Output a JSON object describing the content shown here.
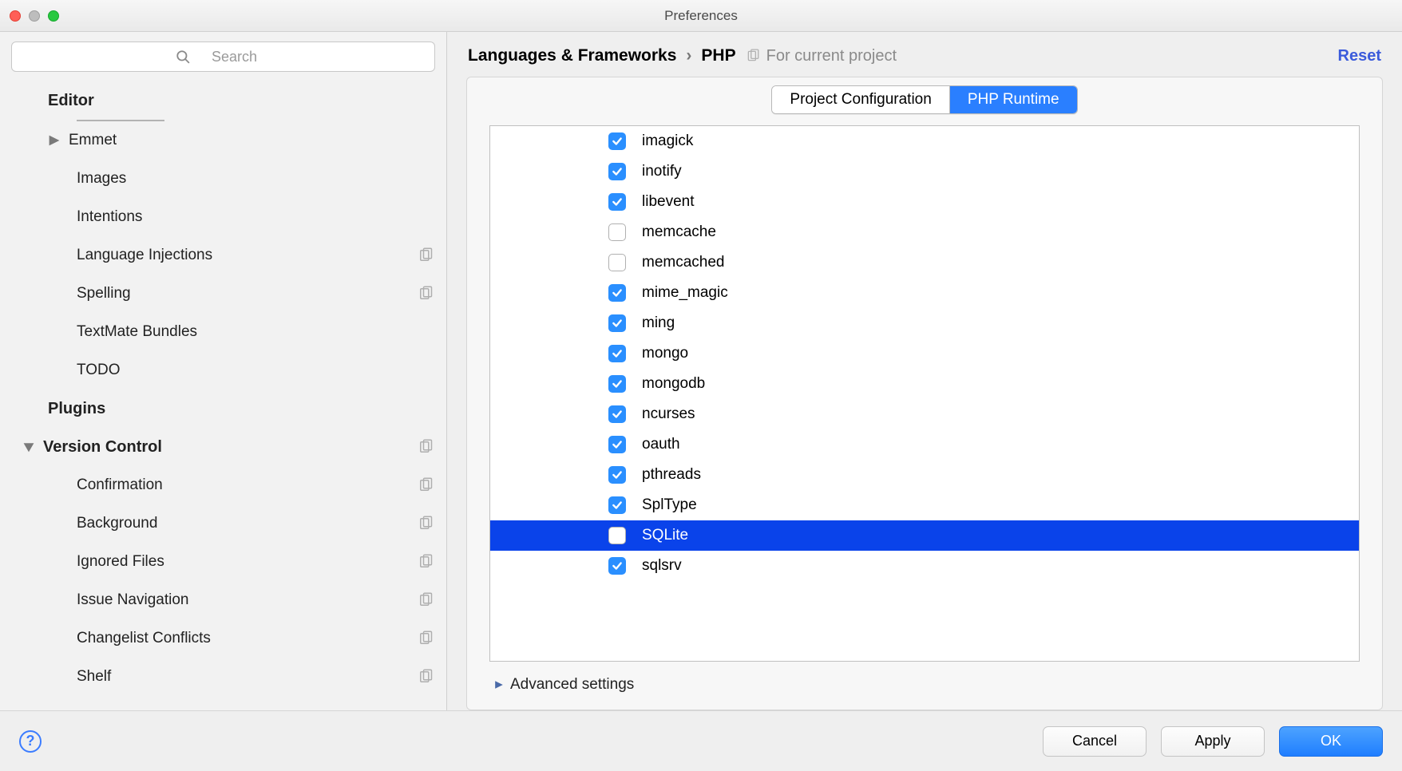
{
  "window": {
    "title": "Preferences"
  },
  "sidebar": {
    "searchPlaceholder": "Search",
    "sections": {
      "editor": {
        "label": "Editor"
      },
      "plugins": {
        "label": "Plugins"
      },
      "vcs": {
        "label": "Version Control"
      }
    },
    "editorChildren": [
      {
        "label": "Emmet",
        "expandable": true
      },
      {
        "label": "Images"
      },
      {
        "label": "Intentions"
      },
      {
        "label": "Language Injections",
        "copyIcon": true
      },
      {
        "label": "Spelling",
        "copyIcon": true
      },
      {
        "label": "TextMate Bundles"
      },
      {
        "label": "TODO"
      }
    ],
    "vcsChildren": [
      {
        "label": "Confirmation",
        "copyIcon": true
      },
      {
        "label": "Background",
        "copyIcon": true
      },
      {
        "label": "Ignored Files",
        "copyIcon": true
      },
      {
        "label": "Issue Navigation",
        "copyIcon": true
      },
      {
        "label": "Changelist Conflicts",
        "copyIcon": true
      },
      {
        "label": "Shelf",
        "copyIcon": true
      }
    ]
  },
  "breadcrumb": {
    "root": "Languages & Frameworks",
    "leaf": "PHP",
    "scope": "For current project",
    "reset": "Reset"
  },
  "tabs": {
    "project": "Project Configuration",
    "runtime": "PHP Runtime"
  },
  "extensions": [
    {
      "name": "imagick",
      "checked": true
    },
    {
      "name": "inotify",
      "checked": true
    },
    {
      "name": "libevent",
      "checked": true
    },
    {
      "name": "memcache",
      "checked": false
    },
    {
      "name": "memcached",
      "checked": false
    },
    {
      "name": "mime_magic",
      "checked": true
    },
    {
      "name": "ming",
      "checked": true
    },
    {
      "name": "mongo",
      "checked": true
    },
    {
      "name": "mongodb",
      "checked": true
    },
    {
      "name": "ncurses",
      "checked": true
    },
    {
      "name": "oauth",
      "checked": true
    },
    {
      "name": "pthreads",
      "checked": true
    },
    {
      "name": "SplType",
      "checked": true
    },
    {
      "name": "SQLite",
      "checked": false,
      "selected": true
    },
    {
      "name": "sqlsrv",
      "checked": true
    }
  ],
  "advanced": {
    "label": "Advanced settings"
  },
  "footer": {
    "cancel": "Cancel",
    "apply": "Apply",
    "ok": "OK"
  }
}
